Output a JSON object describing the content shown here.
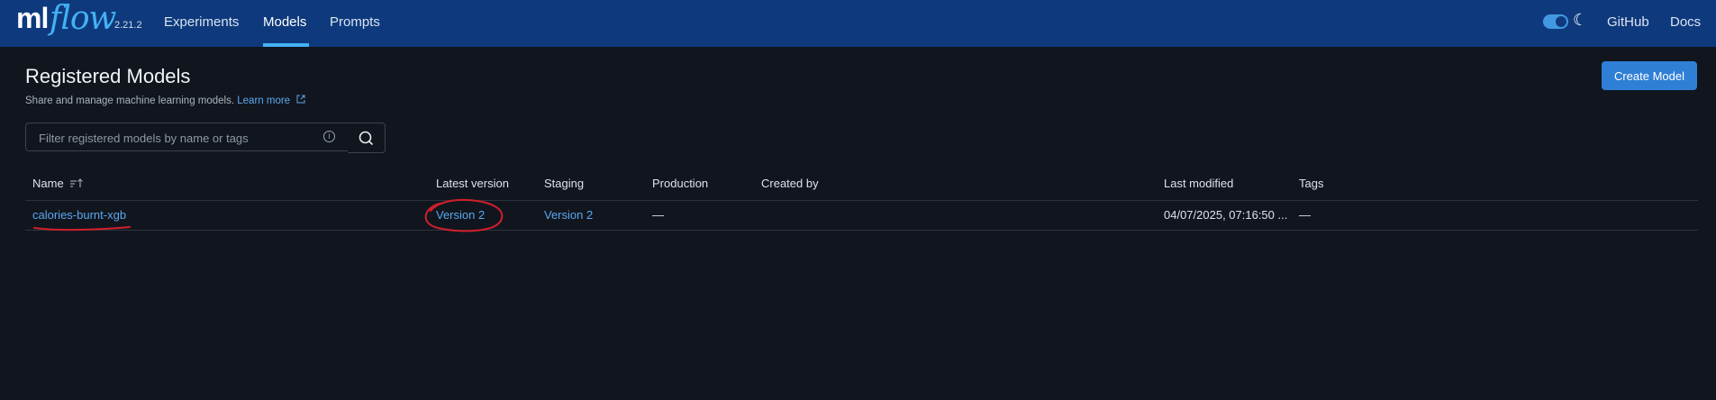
{
  "header": {
    "logo": {
      "ml": "ml",
      "flow": "flow",
      "version": "2.21.2"
    },
    "nav": [
      {
        "label": "Experiments",
        "active": false
      },
      {
        "label": "Models",
        "active": true
      },
      {
        "label": "Prompts",
        "active": false
      }
    ],
    "theme_toggle": {
      "on": true,
      "icon": "moon-icon"
    },
    "links": [
      {
        "label": "GitHub"
      },
      {
        "label": "Docs"
      }
    ],
    "colors": {
      "background": "#0e3a7d",
      "accent": "#43b3f5"
    }
  },
  "page": {
    "title": "Registered Models",
    "subtitle": "Share and manage machine learning models.",
    "learn_more": "Learn more",
    "create_button": "Create Model"
  },
  "search": {
    "placeholder": "Filter registered models by name or tags",
    "value": ""
  },
  "table": {
    "columns": [
      "Name",
      "Latest version",
      "Staging",
      "Production",
      "Created by",
      "Last modified",
      "Tags"
    ],
    "rows": [
      {
        "name": "calories-burnt-xgb",
        "latest_version": "Version 2",
        "staging": "Version 2",
        "production": "—",
        "created_by": "",
        "last_modified": "04/07/2025, 07:16:50 ...",
        "tags": "—"
      }
    ]
  },
  "annotation_color": "#d21f2b"
}
